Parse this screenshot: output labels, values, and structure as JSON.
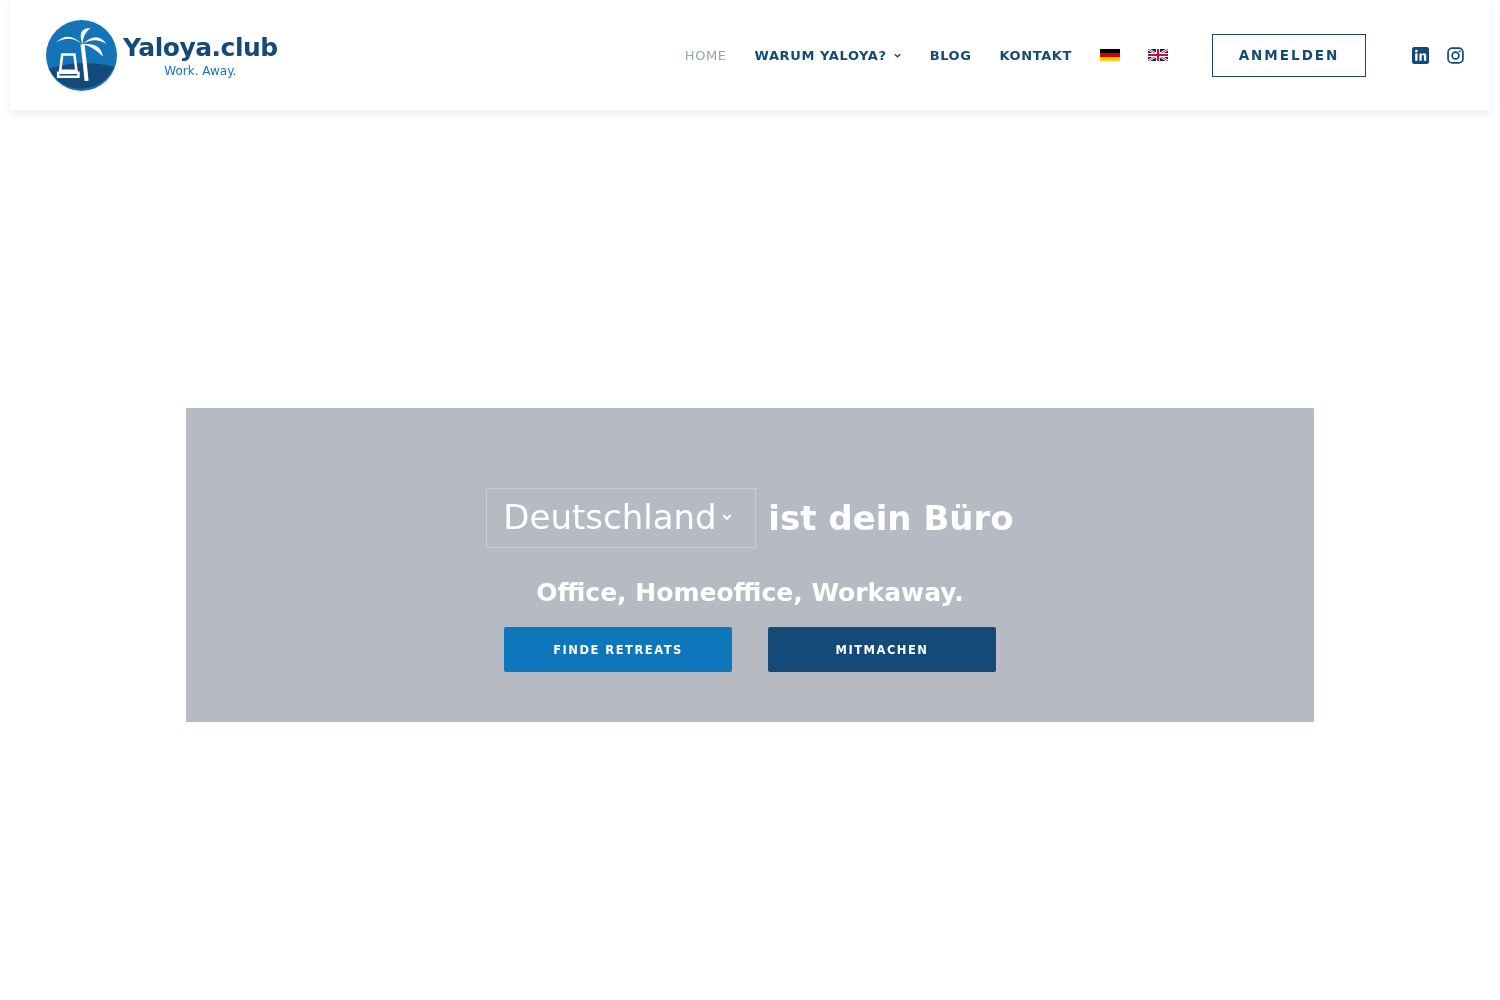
{
  "logo": {
    "name": "Yaloya.club",
    "tagline": "Work. Away."
  },
  "nav": [
    {
      "label": "HOME",
      "selected": true,
      "has_dropdown": false
    },
    {
      "label": "WARUM YALOYA?",
      "selected": false,
      "has_dropdown": true
    },
    {
      "label": "BLOG",
      "selected": false,
      "has_dropdown": false
    },
    {
      "label": "KONTAKT",
      "selected": false,
      "has_dropdown": false
    }
  ],
  "languages": [
    {
      "kind": "german"
    },
    {
      "kind": "british"
    }
  ],
  "login_button": "ANMELDEN",
  "social": [
    {
      "kind": "linkedin"
    },
    {
      "kind": "instagram"
    }
  ],
  "hero": {
    "country_select": {
      "value": "Deutschland"
    },
    "headline": "ist dein Büro",
    "subtitle": "Office, Homeoffice, Workaway.",
    "buttons": [
      {
        "label": "FINDE RETREATS",
        "kind": "primary"
      },
      {
        "label": "MITMACHEN",
        "kind": "secondary"
      }
    ]
  }
}
